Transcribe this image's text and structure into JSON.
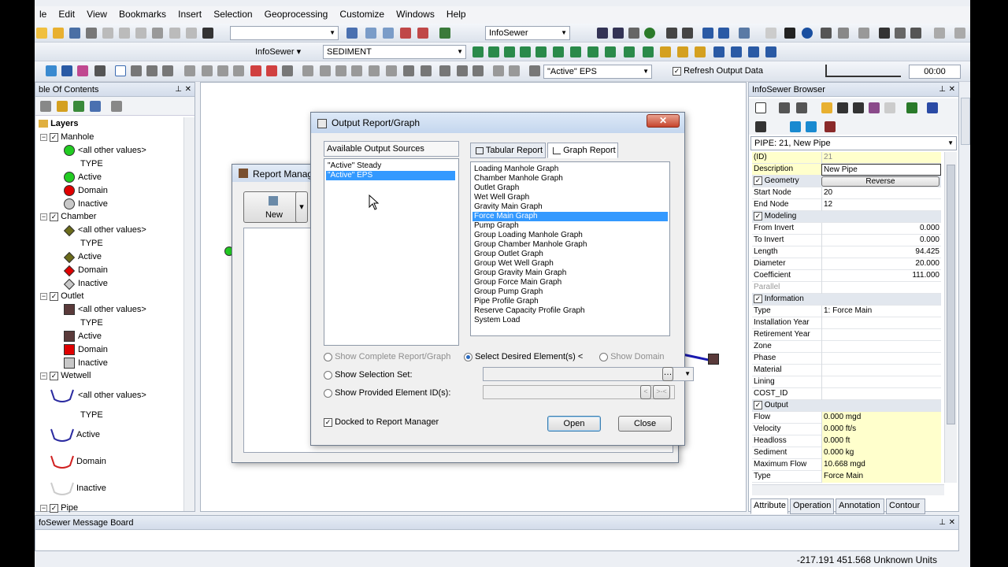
{
  "menubar": {
    "items": [
      "le",
      "Edit",
      "View",
      "Bookmarks",
      "Insert",
      "Selection",
      "Geoprocessing",
      "Customize",
      "Windows",
      "Help"
    ]
  },
  "toolbar": {
    "infosewer_combo": "InfoSewer",
    "infosewer_menu": "InfoSewer ▾",
    "sediment_combo": "SEDIMENT",
    "scenario_combo": "\"Active\" EPS",
    "refresh_label": "Refresh Output Data",
    "time_value": "00:00"
  },
  "toc": {
    "title": "ble Of Contents",
    "root": "Layers",
    "layers": [
      {
        "name": "Manhole",
        "other": "<all other values>",
        "type": "TYPE",
        "items": [
          "Active",
          "Domain",
          "Inactive"
        ]
      },
      {
        "name": "Chamber",
        "other": "<all other values>",
        "type": "TYPE",
        "items": [
          "Active",
          "Domain",
          "Inactive"
        ]
      },
      {
        "name": "Outlet",
        "other": "<all other values>",
        "type": "TYPE",
        "items": [
          "Active",
          "Domain",
          "Inactive"
        ]
      },
      {
        "name": "Wetwell",
        "other": "<all other values>",
        "type": "TYPE",
        "items": [
          "Active",
          "Domain",
          "Inactive"
        ]
      },
      {
        "name": "Pipe"
      }
    ]
  },
  "report_manager": {
    "title": "Report Manag",
    "new_label": "New"
  },
  "dialog": {
    "title": "Output Report/Graph",
    "sources_header": "Available Output Sources",
    "sources": [
      "\"Active\" Steady",
      "\"Active\" EPS"
    ],
    "tabs": [
      "Tabular Report",
      "Graph Report"
    ],
    "graphs": [
      "Loading Manhole Graph",
      "Chamber Manhole Graph",
      "Outlet Graph",
      "Wet Well Graph",
      "Gravity Main Graph",
      "Force Main Graph",
      "Pump Graph",
      "Group Loading Manhole Graph",
      "Group Chamber Manhole Graph",
      "Group Outlet Graph",
      "Group Wet Well Graph",
      "Group Gravity Main Graph",
      "Group Force Main Graph",
      "Group Pump Graph",
      "Pipe Profile Graph",
      "Reserve Capacity Profile Graph",
      "System Load"
    ],
    "opt_complete": "Show Complete Report/Graph",
    "opt_desired": "Select Desired Element(s) <",
    "opt_domain": "Show Domain",
    "opt_selection": "Show Selection Set:",
    "opt_provided": "Show Provided Element ID(s):",
    "docked_label": "Docked to Report Manager",
    "open_label": "Open",
    "close_label": "Close"
  },
  "browser": {
    "title": "InfoSewer Browser",
    "selector": "PIPE: 21, New Pipe",
    "reverse_label": "Reverse",
    "rows": [
      {
        "k": "(ID)",
        "v": "21"
      },
      {
        "k": "Description",
        "v": "New Pipe"
      },
      {
        "k": "Geometry",
        "section": true
      },
      {
        "k": "Start Node",
        "v": "20"
      },
      {
        "k": "End Node",
        "v": "12"
      },
      {
        "k": "Modeling",
        "section": true
      },
      {
        "k": "From Invert",
        "v": "0.000",
        "num": true
      },
      {
        "k": "To Invert",
        "v": "0.000",
        "num": true
      },
      {
        "k": "Length",
        "v": "94.425",
        "num": true
      },
      {
        "k": "Diameter",
        "v": "20.000",
        "num": true
      },
      {
        "k": "Coefficient",
        "v": "111.000",
        "num": true
      },
      {
        "k": "Parallel",
        "v": ""
      },
      {
        "k": "Information",
        "section": true
      },
      {
        "k": "Type",
        "v": "1: Force Main"
      },
      {
        "k": "Installation Year",
        "v": ""
      },
      {
        "k": "Retirement Year",
        "v": ""
      },
      {
        "k": "Zone",
        "v": ""
      },
      {
        "k": "Phase",
        "v": ""
      },
      {
        "k": "Material",
        "v": ""
      },
      {
        "k": "Lining",
        "v": ""
      },
      {
        "k": "COST_ID",
        "v": ""
      },
      {
        "k": "Output",
        "section": true
      },
      {
        "k": "Flow",
        "v": "0.000 mgd"
      },
      {
        "k": "Velocity",
        "v": "0.000 ft/s"
      },
      {
        "k": "Headloss",
        "v": "0.000 ft"
      },
      {
        "k": "Sediment",
        "v": "0.000 kg"
      },
      {
        "k": "Maximum Flow",
        "v": "10.668 mgd"
      },
      {
        "k": "Type",
        "v": "Force Main"
      }
    ],
    "tabs": [
      "Attribute",
      "Operation",
      "Annotation",
      "Contour"
    ]
  },
  "message_board": {
    "title": "foSewer Message Board"
  },
  "status": {
    "coords": "-217.191  451.568 Unknown Units"
  },
  "colors": {
    "active_green": "#22cc22",
    "domain_red": "#e00000",
    "inactive_gray": "#c8c8c8",
    "chamber_olive": "#6b6b1a",
    "outlet_brown": "#5a3a3a",
    "selection_blue": "#3399ff"
  }
}
